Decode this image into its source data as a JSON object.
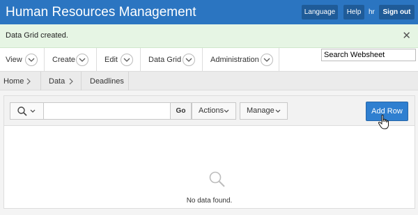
{
  "header": {
    "title": "Human Resources Management",
    "language_label": "Language",
    "help_label": "Help",
    "username": "hr",
    "signout_label": "Sign out"
  },
  "message": {
    "text": "Data Grid created.",
    "close_glyph": "✕"
  },
  "menu": {
    "items": [
      {
        "label": "View"
      },
      {
        "label": "Create"
      },
      {
        "label": "Edit"
      },
      {
        "label": "Data Grid"
      },
      {
        "label": "Administration"
      }
    ],
    "search_value": "Search Websheet"
  },
  "breadcrumb": [
    {
      "label": "Home"
    },
    {
      "label": "Data"
    },
    {
      "label": "Deadlines"
    }
  ],
  "toolbar": {
    "search_value": "",
    "go_label": "Go",
    "actions_label": "Actions",
    "manage_label": "Manage",
    "add_row_label": "Add Row"
  },
  "grid": {
    "empty_text": "No data found."
  },
  "colors": {
    "header": "#2b75c1",
    "accent": "#2f7fd0",
    "success_bg": "#e6f5e4"
  },
  "icons": [
    "search-icon",
    "chevron-down-icon",
    "chevron-right-icon",
    "close-icon",
    "hand-cursor-icon"
  ]
}
